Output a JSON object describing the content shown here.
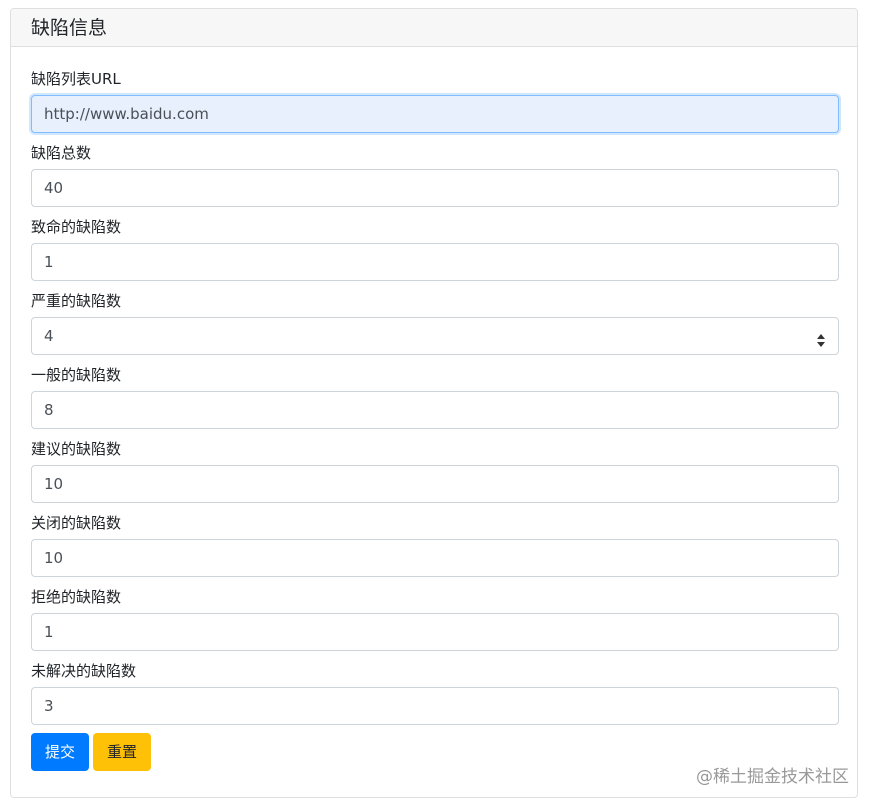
{
  "card": {
    "title": "缺陷信息"
  },
  "fields": [
    {
      "label": "缺陷列表URL",
      "value": "http://www.baidu.com"
    },
    {
      "label": "缺陷总数",
      "value": "40"
    },
    {
      "label": "致命的缺陷数",
      "value": "1"
    },
    {
      "label": "严重的缺陷数",
      "value": "4"
    },
    {
      "label": "一般的缺陷数",
      "value": "8"
    },
    {
      "label": "建议的缺陷数",
      "value": "10"
    },
    {
      "label": "关闭的缺陷数",
      "value": "10"
    },
    {
      "label": "拒绝的缺陷数",
      "value": "1"
    },
    {
      "label": "未解决的缺陷数",
      "value": "3"
    }
  ],
  "buttons": {
    "submit": "提交",
    "reset": "重置"
  },
  "watermark": "@稀土掘金技术社区",
  "colors": {
    "primary": "#007bff",
    "warning": "#ffc107",
    "focus_bg": "#e8f0fe"
  }
}
